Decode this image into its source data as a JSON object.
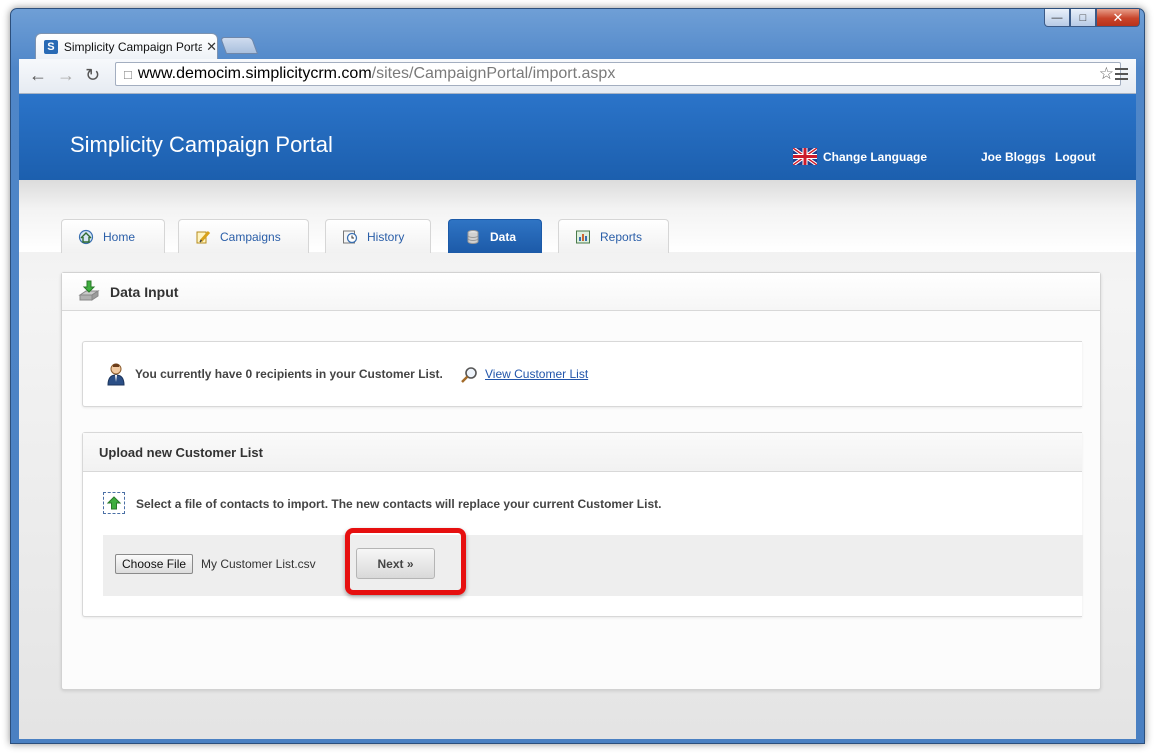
{
  "browser": {
    "tab_title": "Simplicity Campaign Portal",
    "favicon_letter": "S",
    "url_host": "www.democim.simplicitycrm.com",
    "url_path": "/sites/CampaignPortal/import.aspx"
  },
  "header": {
    "title": "Simplicity Campaign Portal",
    "change_language": "Change Language",
    "user_name": "Joe Bloggs",
    "logout": "Logout"
  },
  "nav": {
    "tabs": [
      {
        "label": "Home",
        "icon": "home-icon"
      },
      {
        "label": "Campaigns",
        "icon": "pencil-icon"
      },
      {
        "label": "History",
        "icon": "history-icon"
      },
      {
        "label": "Data",
        "icon": "database-icon",
        "active": true
      },
      {
        "label": "Reports",
        "icon": "reports-icon"
      }
    ]
  },
  "panel": {
    "title": "Data Input",
    "info_text": "You currently have 0 recipients in your Customer List.",
    "view_link": "View Customer List",
    "upload_title": "Upload new Customer List",
    "upload_text": "Select a file of contacts to import. The new contacts will replace your current Customer List.",
    "choose_file_label": "Choose File",
    "selected_file": "My Customer List.csv",
    "next_label": "Next »"
  },
  "colors": {
    "header_blue": "#1c5fae",
    "link_blue": "#2255aa",
    "highlight_red": "#e60f0f"
  }
}
